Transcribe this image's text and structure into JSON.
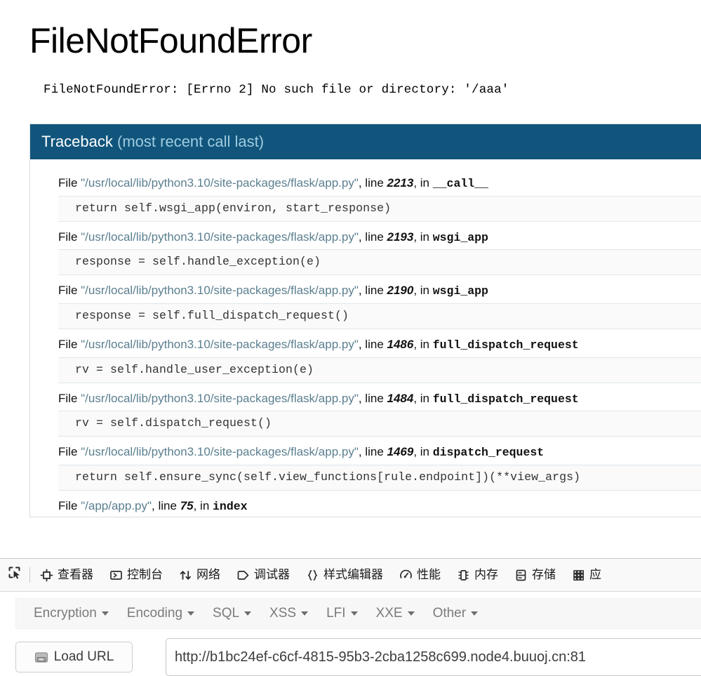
{
  "flask": {
    "error_title": "FileNotFoundError",
    "error_detail": "FileNotFoundError: [Errno 2] No such file or directory: '/aaa'",
    "traceback_header_main": "Traceback ",
    "traceback_header_sub": "(most recent call last)",
    "header_bg": "#11557c",
    "frames": [
      {
        "file_prefix": "File ",
        "filename": "\"/usr/local/lib/python3.10/site-packages/flask/app.py\"",
        "line_label": ", line ",
        "lineno": "2213",
        "in_label": ", in ",
        "function": "__call__",
        "code": "return self.wsgi_app(environ, start_response)"
      },
      {
        "file_prefix": "File ",
        "filename": "\"/usr/local/lib/python3.10/site-packages/flask/app.py\"",
        "line_label": ", line ",
        "lineno": "2193",
        "in_label": ", in ",
        "function": "wsgi_app",
        "code": "response = self.handle_exception(e)"
      },
      {
        "file_prefix": "File ",
        "filename": "\"/usr/local/lib/python3.10/site-packages/flask/app.py\"",
        "line_label": ", line ",
        "lineno": "2190",
        "in_label": ", in ",
        "function": "wsgi_app",
        "code": "response = self.full_dispatch_request()"
      },
      {
        "file_prefix": "File ",
        "filename": "\"/usr/local/lib/python3.10/site-packages/flask/app.py\"",
        "line_label": ", line ",
        "lineno": "1486",
        "in_label": ", in ",
        "function": "full_dispatch_request",
        "code": "rv = self.handle_user_exception(e)"
      },
      {
        "file_prefix": "File ",
        "filename": "\"/usr/local/lib/python3.10/site-packages/flask/app.py\"",
        "line_label": ", line ",
        "lineno": "1484",
        "in_label": ", in ",
        "function": "full_dispatch_request",
        "code": "rv = self.dispatch_request()"
      },
      {
        "file_prefix": "File ",
        "filename": "\"/usr/local/lib/python3.10/site-packages/flask/app.py\"",
        "line_label": ", line ",
        "lineno": "1469",
        "in_label": ", in ",
        "function": "dispatch_request",
        "code": "return self.ensure_sync(self.view_functions[rule.endpoint])(**view_args)"
      },
      {
        "file_prefix": "File ",
        "filename": "\"/app/app.py\"",
        "line_label": ", line ",
        "lineno": "75",
        "in_label": ", in ",
        "function": "index",
        "code": ""
      }
    ]
  },
  "devtools": {
    "picker_icon": "element-picker-icon",
    "tabs": [
      {
        "label": "查看器",
        "icon": "inspector-icon"
      },
      {
        "label": "控制台",
        "icon": "console-icon"
      },
      {
        "label": "网络",
        "icon": "network-icon"
      },
      {
        "label": "调试器",
        "icon": "debugger-icon"
      },
      {
        "label": "样式编辑器",
        "icon": "style-editor-icon"
      },
      {
        "label": "性能",
        "icon": "performance-icon"
      },
      {
        "label": "内存",
        "icon": "memory-icon"
      },
      {
        "label": "存储",
        "icon": "storage-icon"
      },
      {
        "label": "应",
        "icon": "application-icon"
      }
    ]
  },
  "hackbar": {
    "menu_items": [
      {
        "label": "Encryption"
      },
      {
        "label": "Encoding"
      },
      {
        "label": "SQL"
      },
      {
        "label": "XSS"
      },
      {
        "label": "LFI"
      },
      {
        "label": "XXE"
      },
      {
        "label": "Other"
      }
    ],
    "load_url_label": "Load URL",
    "load_url_icon": "drive-icon",
    "url_value": "http://b1bc24ef-c6cf-4815-95b3-2cba1258c699.node4.buuoj.cn:81"
  }
}
